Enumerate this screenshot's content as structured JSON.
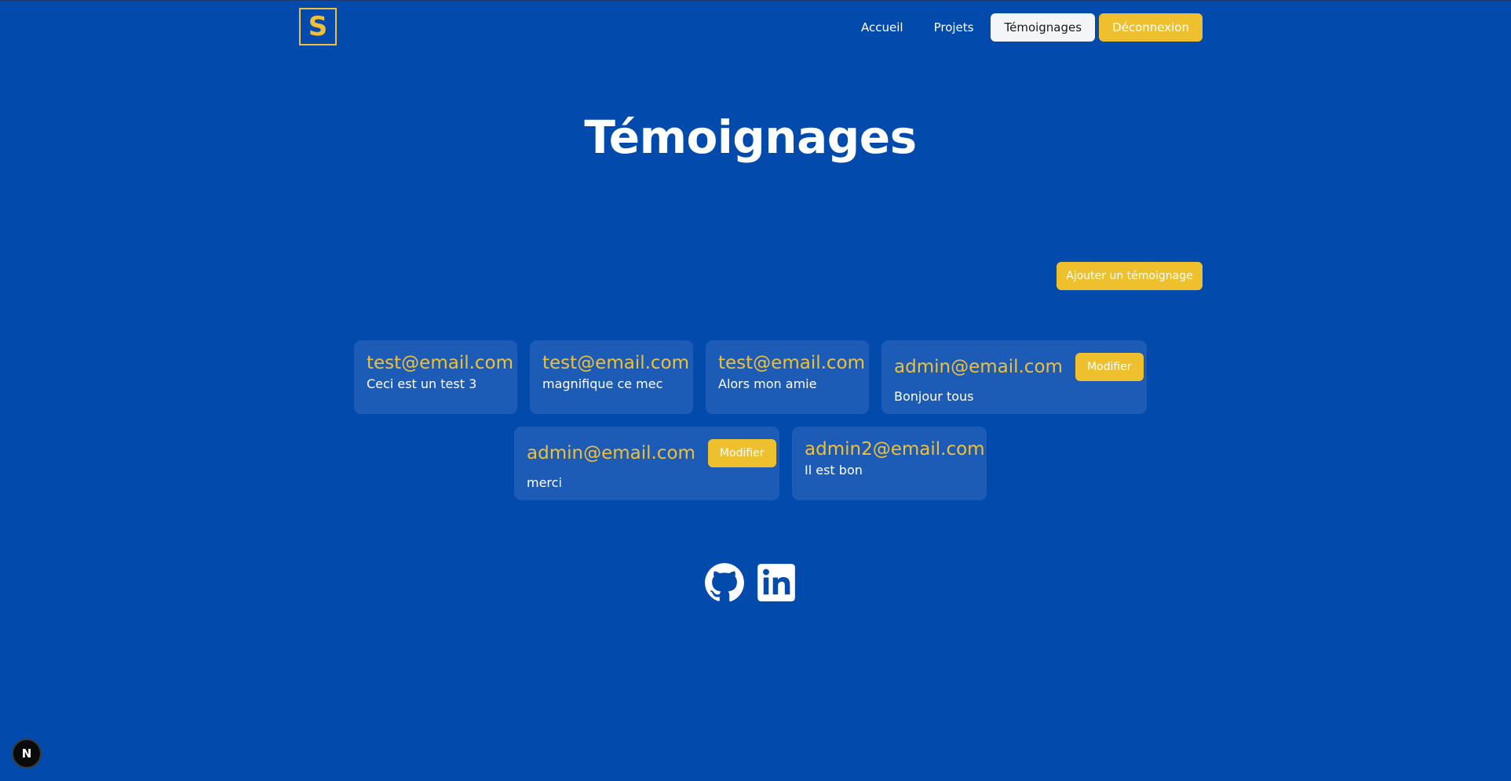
{
  "header": {
    "logo_letter": "S",
    "nav": [
      "Accueil",
      "Projets",
      "Témoignages"
    ],
    "logout_label": "Déconnexion"
  },
  "page_title": "Témoignages",
  "add_button_label": "Ajouter un témoignage",
  "testimonials": [
    {
      "email": "test@email.com",
      "message": "Ceci est un test 3"
    },
    {
      "email": "test@email.com",
      "message": "magnifique ce mec"
    },
    {
      "email": "test@email.com",
      "message": "Alors mon amie"
    },
    {
      "email": "admin@email.com",
      "message": "Bonjour tous",
      "button": "Modifier"
    },
    {
      "email": "admin@email.com",
      "message": "merci",
      "button": "Modifier"
    },
    {
      "email": "admin2@email.com",
      "message": "Il est bon"
    }
  ],
  "socials": [
    "github-icon",
    "linkedin-icon"
  ],
  "dev_badge": "N",
  "colors": {
    "background": "#034aad",
    "accent": "#efc02e",
    "card": "#1c5cb6"
  }
}
